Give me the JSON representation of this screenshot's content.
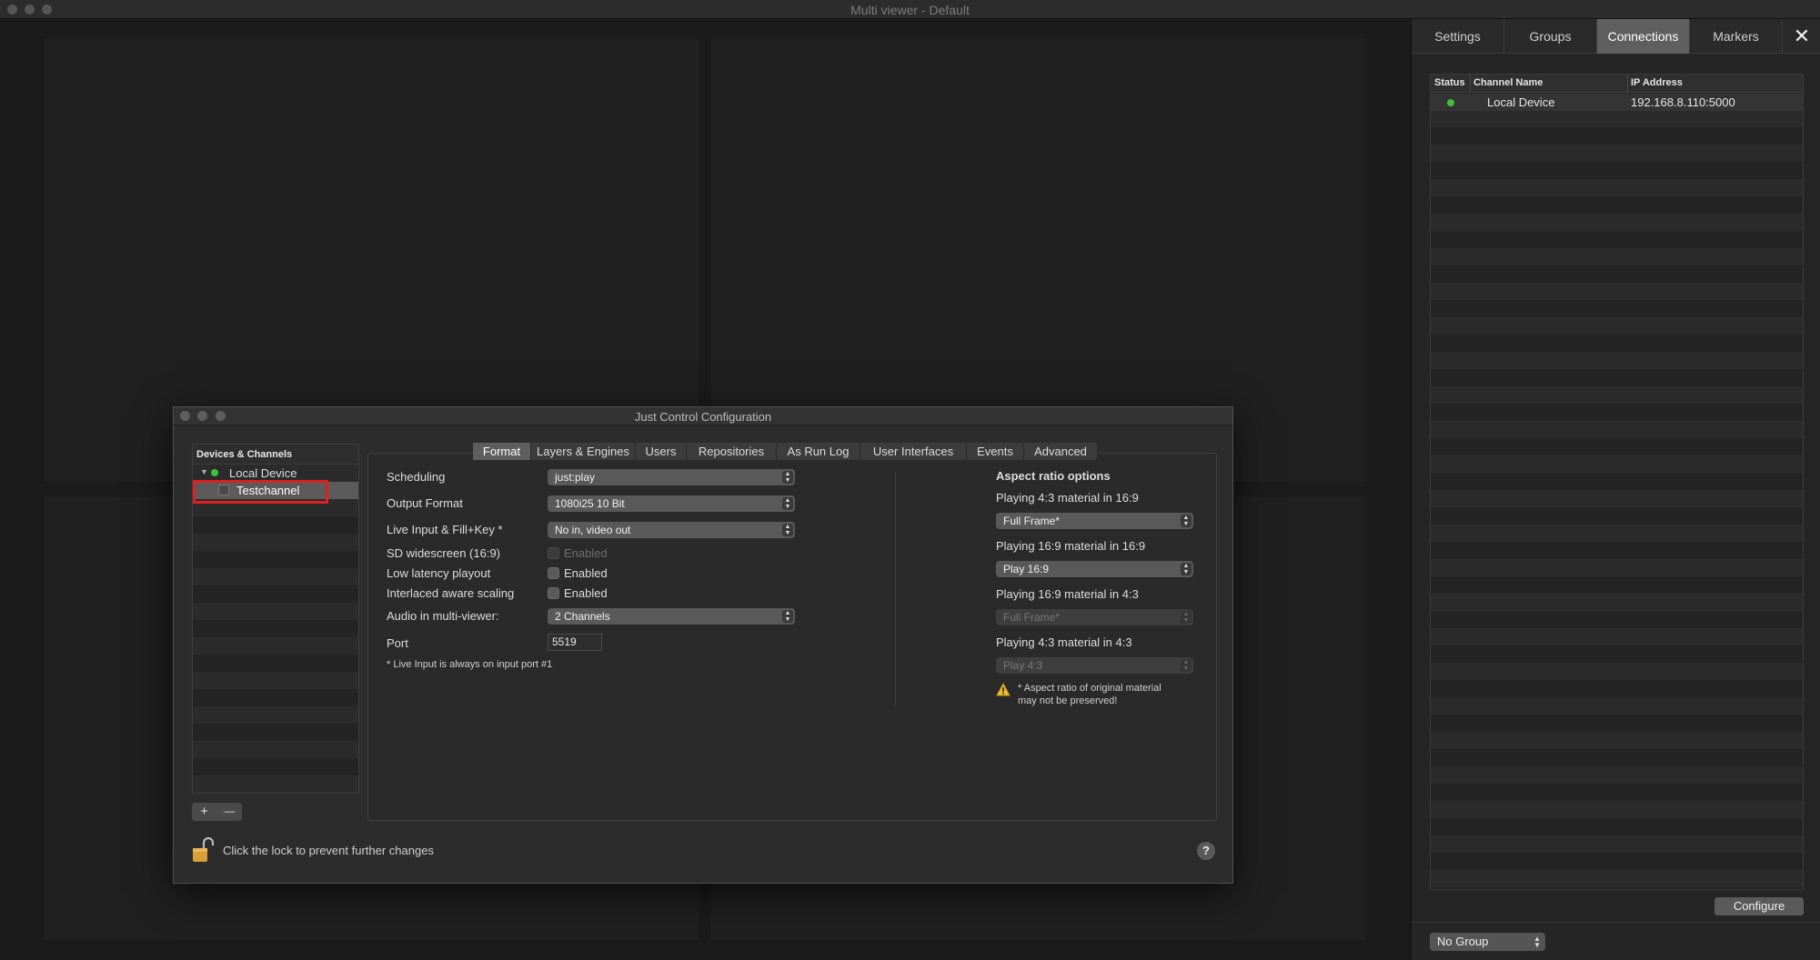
{
  "window": {
    "title": "Multi viewer - Default"
  },
  "right_panel": {
    "tabs": [
      "Settings",
      "Groups",
      "Connections",
      "Markers"
    ],
    "active_tab": "Connections",
    "close_glyph": "✕",
    "table": {
      "columns": [
        "Status",
        "Channel Name",
        "IP Address"
      ],
      "rows": [
        {
          "status": "online",
          "channel_name": "Local Device",
          "ip_address": "192.168.8.110:5000"
        }
      ]
    },
    "configure_label": "Configure",
    "group_select": "No Group"
  },
  "dialog": {
    "title": "Just Control Configuration",
    "devices": {
      "header": "Devices & Channels",
      "device": "Local Device",
      "channel": "Testchannel"
    },
    "add_glyph": "+",
    "remove_glyph": "—",
    "lock_text": "Click the lock to prevent further changes",
    "help_glyph": "?",
    "tabs": [
      "Format",
      "Layers & Engines",
      "Users",
      "Repositories",
      "As Run Log",
      "User Interfaces",
      "Events",
      "Advanced"
    ],
    "active_tab": "Format",
    "format": {
      "scheduling_label": "Scheduling",
      "scheduling_value": "just:play",
      "output_format_label": "Output Format",
      "output_format_value": "1080i25 10 Bit",
      "live_input_label": "Live Input & Fill+Key *",
      "live_input_value": "No in, video out",
      "sd_widescreen_label": "SD widescreen (16:9)",
      "sd_widescreen_cb": "Enabled",
      "low_latency_label": "Low latency playout",
      "low_latency_cb": "Enabled",
      "interlaced_label": "Interlaced aware scaling",
      "interlaced_cb": "Enabled",
      "audio_label": "Audio in multi-viewer:",
      "audio_value": "2 Channels",
      "port_label": "Port",
      "port_value": "5519",
      "footnote": "* Live Input is always on input port #1"
    },
    "aspect": {
      "heading": "Aspect ratio options",
      "opt1_label": "Playing 4:3 material in 16:9",
      "opt1_value": "Full Frame*",
      "opt2_label": "Playing 16:9 material in 16:9",
      "opt2_value": "Play 16:9",
      "opt3_label": "Playing 16:9 material in 4:3",
      "opt3_value": "Full Frame*",
      "opt4_label": "Playing 4:3 material in 4:3",
      "opt4_value": "Play 4:3",
      "warning_line1": "* Aspect ratio of original material",
      "warning_line2": "may not be preserved!"
    }
  },
  "colors": {
    "status_online": "#3cc23c",
    "highlight": "#e02020"
  }
}
